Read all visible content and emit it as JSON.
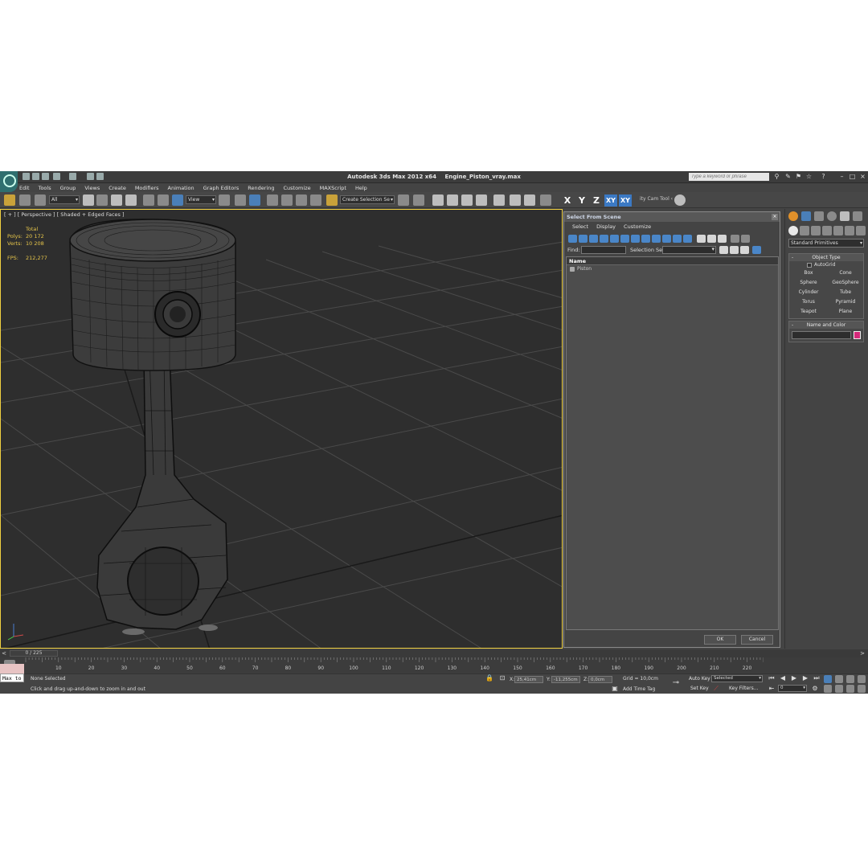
{
  "app": {
    "title": "Autodesk 3ds Max  2012 x64",
    "file": "Engine_Piston_vray.max",
    "search_placeholder": "Type a keyword or phrase"
  },
  "menu": [
    "Edit",
    "Tools",
    "Group",
    "Views",
    "Create",
    "Modifiers",
    "Animation",
    "Graph Editors",
    "Rendering",
    "Customize",
    "MAXScript",
    "Help"
  ],
  "toolbar": {
    "filter": "All",
    "ref_coord": "View",
    "selection_set": "Create Selection Se",
    "axes": [
      "X",
      "Y",
      "Z",
      "XY",
      "XY"
    ],
    "cam_tool": "ity Cam Tool ‹"
  },
  "viewport": {
    "label": "[ + ] [ Perspective ] [ Shaded + Edged Faces ]",
    "stats_header": "Total",
    "stats": [
      {
        "label": "Polys:",
        "value": "20 172"
      },
      {
        "label": "Verts:",
        "value": "10 208"
      }
    ],
    "fps_label": "FPS:",
    "fps_value": "212,277"
  },
  "dialog": {
    "title": "Select From Scene",
    "menu": [
      "Select",
      "Display",
      "Customize"
    ],
    "find_label": "Find:",
    "selection_set_label": "Selection Set:",
    "column_name": "Name",
    "items": [
      "Piston"
    ],
    "ok": "OK",
    "cancel": "Cancel"
  },
  "command_panel": {
    "category": "Standard Primitives",
    "object_type_title": "Object Type",
    "autogrid": "AutoGrid",
    "primitives": [
      "Box",
      "Cone",
      "Sphere",
      "GeoSphere",
      "Cylinder",
      "Tube",
      "Torus",
      "Pyramid",
      "Teapot",
      "Plane"
    ],
    "name_color_title": "Name and Color",
    "color": "#d6297a"
  },
  "timeline": {
    "frame_display": "0 / 225",
    "ticks": [
      "10",
      "20",
      "30",
      "40",
      "50",
      "60",
      "70",
      "80",
      "90",
      "100",
      "110",
      "120",
      "130",
      "140",
      "150",
      "160",
      "170",
      "180",
      "190",
      "200",
      "210",
      "220"
    ]
  },
  "status": {
    "maxscript": "Max to",
    "selection": "None Selected",
    "prompt": "Click and drag up-and-down to zoom in and out",
    "x_label": "X:",
    "x_value": "25,41cm",
    "y_label": "Y:",
    "y_value": "-11,255cm",
    "z_label": "Z:",
    "z_value": "0,0cm",
    "grid": "Grid = 10,0cm",
    "add_time_tag": "Add Time Tag",
    "auto_key": "Auto Key",
    "set_key": "Set Key",
    "selected": "Selected",
    "key_filters": "Key Filters...",
    "frame": "0"
  }
}
